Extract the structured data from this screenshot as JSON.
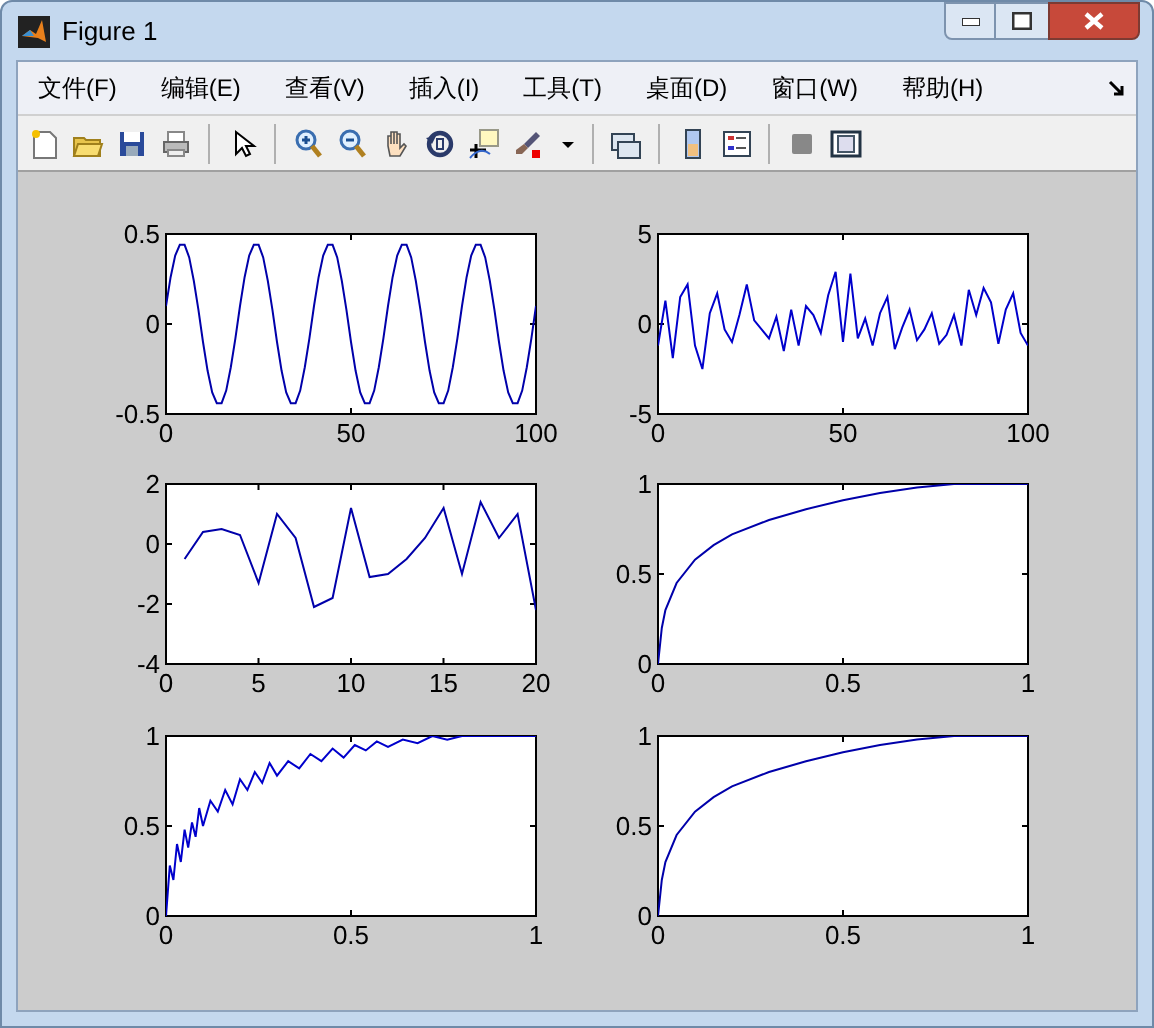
{
  "window": {
    "title": "Figure 1"
  },
  "menu": [
    "文件(F)",
    "编辑(E)",
    "查看(V)",
    "插入(I)",
    "工具(T)",
    "桌面(D)",
    "窗口(W)",
    "帮助(H)"
  ],
  "plots": [
    {
      "chart_data": {
        "type": "line",
        "x": [
          0,
          1.25,
          2.5,
          3.75,
          5,
          6.25,
          7.5,
          8.75,
          10,
          11.25,
          12.5,
          13.75,
          15,
          16.25,
          17.5,
          18.75,
          20,
          21.25,
          22.5,
          23.75,
          25,
          26.25,
          27.5,
          28.75,
          30,
          31.25,
          32.5,
          33.75,
          35,
          36.25,
          37.5,
          38.75,
          40,
          41.25,
          42.5,
          43.75,
          45,
          46.25,
          47.5,
          48.75,
          50,
          51.25,
          52.5,
          53.75,
          55,
          56.25,
          57.5,
          58.75,
          60,
          61.25,
          62.5,
          63.75,
          65,
          66.25,
          67.5,
          68.75,
          70,
          71.25,
          72.5,
          73.75,
          75,
          76.25,
          77.5,
          78.75,
          80,
          81.25,
          82.5,
          83.75,
          85,
          86.25,
          87.5,
          88.75,
          90,
          91.25,
          92.5,
          93.75,
          95,
          96.25,
          97.5,
          98.75,
          100
        ],
        "series": [
          {
            "color": "#0000aa",
            "values": [
              0.1,
              0.26,
              0.38,
              0.44,
              0.44,
              0.37,
              0.24,
              0.08,
              -0.1,
              -0.26,
              -0.38,
              -0.44,
              -0.44,
              -0.37,
              -0.24,
              -0.08,
              0.1,
              0.26,
              0.38,
              0.44,
              0.44,
              0.37,
              0.24,
              0.08,
              -0.1,
              -0.26,
              -0.38,
              -0.44,
              -0.44,
              -0.37,
              -0.24,
              -0.08,
              0.1,
              0.26,
              0.38,
              0.44,
              0.44,
              0.37,
              0.24,
              0.08,
              -0.1,
              -0.26,
              -0.38,
              -0.44,
              -0.44,
              -0.37,
              -0.24,
              -0.08,
              0.1,
              0.26,
              0.38,
              0.44,
              0.44,
              0.37,
              0.24,
              0.08,
              -0.1,
              -0.26,
              -0.38,
              -0.44,
              -0.44,
              -0.37,
              -0.24,
              -0.08,
              0.1,
              0.26,
              0.38,
              0.44,
              0.44,
              0.37,
              0.24,
              0.08,
              -0.1,
              -0.26,
              -0.38,
              -0.44,
              -0.44,
              -0.37,
              -0.24,
              -0.08,
              0.1
            ]
          }
        ],
        "xlim": [
          0,
          100
        ],
        "ylim": [
          -0.5,
          0.5
        ],
        "xticks": [
          0,
          50,
          100
        ],
        "yticks": [
          -0.5,
          0,
          0.5
        ]
      }
    },
    {
      "chart_data": {
        "type": "line",
        "x": [
          0,
          2,
          4,
          6,
          8,
          10,
          12,
          14,
          16,
          18,
          20,
          22,
          24,
          26,
          28,
          30,
          32,
          34,
          36,
          38,
          40,
          42,
          44,
          46,
          48,
          50,
          52,
          54,
          56,
          58,
          60,
          62,
          64,
          66,
          68,
          70,
          72,
          74,
          76,
          78,
          80,
          82,
          84,
          86,
          88,
          90,
          92,
          94,
          96,
          98,
          100
        ],
        "series": [
          {
            "color": "#0000cc",
            "values": [
              -1.2,
              1.3,
              -1.9,
              1.5,
              2.2,
              -1.2,
              -2.5,
              0.6,
              1.7,
              -0.3,
              -1,
              0.5,
              2.2,
              0.2,
              -0.3,
              -0.8,
              0.4,
              -1.5,
              0.8,
              -1.2,
              1,
              0.5,
              -0.5,
              1.6,
              2.9,
              -1,
              2.8,
              -0.8,
              0.3,
              -1.2,
              0.6,
              1.5,
              -1.4,
              -0.2,
              0.8,
              -0.9,
              -0.3,
              0.6,
              -1.1,
              -0.6,
              0.5,
              -1.2,
              1.9,
              0.5,
              2,
              1.2,
              -1.1,
              0.8,
              1.7,
              -0.5,
              -1.2
            ]
          }
        ],
        "xlim": [
          0,
          100
        ],
        "ylim": [
          -5,
          5
        ],
        "xticks": [
          0,
          50,
          100
        ],
        "yticks": [
          -5,
          0,
          5
        ]
      }
    },
    {
      "chart_data": {
        "type": "line",
        "x": [
          1,
          2,
          3,
          4,
          5,
          6,
          7,
          8,
          9,
          10,
          11,
          12,
          13,
          14,
          15,
          16,
          17,
          18,
          19,
          20
        ],
        "series": [
          {
            "color": "#0000aa",
            "values": [
              -0.5,
              0.4,
              0.5,
              0.3,
              -1.3,
              1,
              0.2,
              -2.1,
              -1.8,
              1.2,
              -1.1,
              -1,
              -0.5,
              0.2,
              1.2,
              -1,
              1.4,
              0.2,
              1,
              -2.2
            ]
          }
        ],
        "xlim": [
          0,
          20
        ],
        "ylim": [
          -4,
          2
        ],
        "xticks": [
          0,
          5,
          10,
          15,
          20
        ],
        "yticks": [
          -4,
          -2,
          0,
          2
        ]
      }
    },
    {
      "chart_data": {
        "type": "line",
        "x": [
          0,
          0.01,
          0.02,
          0.05,
          0.1,
          0.15,
          0.2,
          0.3,
          0.4,
          0.5,
          0.6,
          0.7,
          0.8,
          0.9,
          1
        ],
        "series": [
          {
            "color": "#0000aa",
            "values": [
              0,
              0.2,
              0.3,
              0.45,
              0.58,
              0.66,
              0.72,
              0.8,
              0.86,
              0.91,
              0.95,
              0.98,
              1,
              1,
              1
            ]
          }
        ],
        "xlim": [
          0,
          1
        ],
        "ylim": [
          0,
          1
        ],
        "xticks": [
          0,
          0.5,
          1
        ],
        "yticks": [
          0,
          0.5,
          1
        ]
      }
    },
    {
      "chart_data": {
        "type": "line",
        "x": [
          0,
          0.01,
          0.02,
          0.03,
          0.04,
          0.05,
          0.06,
          0.07,
          0.08,
          0.09,
          0.1,
          0.12,
          0.14,
          0.16,
          0.18,
          0.2,
          0.22,
          0.24,
          0.26,
          0.28,
          0.3,
          0.33,
          0.36,
          0.39,
          0.42,
          0.45,
          0.48,
          0.51,
          0.54,
          0.57,
          0.6,
          0.64,
          0.68,
          0.72,
          0.76,
          0.8,
          0.85,
          0.9,
          0.95,
          1
        ],
        "series": [
          {
            "color": "#0000cc",
            "values": [
              0,
              0.28,
              0.2,
              0.4,
              0.3,
              0.48,
              0.38,
              0.52,
              0.44,
              0.6,
              0.5,
              0.64,
              0.58,
              0.7,
              0.62,
              0.76,
              0.7,
              0.8,
              0.74,
              0.85,
              0.78,
              0.86,
              0.82,
              0.9,
              0.86,
              0.93,
              0.88,
              0.95,
              0.92,
              0.97,
              0.94,
              0.98,
              0.96,
              1,
              0.98,
              1,
              1,
              1,
              1,
              1
            ]
          }
        ],
        "xlim": [
          0,
          1
        ],
        "ylim": [
          0,
          1
        ],
        "xticks": [
          0,
          0.5,
          1
        ],
        "yticks": [
          0,
          0.5,
          1
        ]
      }
    },
    {
      "chart_data": {
        "type": "line",
        "x": [
          0,
          0.01,
          0.02,
          0.05,
          0.1,
          0.15,
          0.2,
          0.3,
          0.4,
          0.5,
          0.6,
          0.7,
          0.8,
          0.9,
          1
        ],
        "series": [
          {
            "color": "#0000aa",
            "values": [
              0,
              0.2,
              0.3,
              0.45,
              0.58,
              0.66,
              0.72,
              0.8,
              0.86,
              0.91,
              0.95,
              0.98,
              1,
              1,
              1
            ]
          }
        ],
        "xlim": [
          0,
          1
        ],
        "ylim": [
          0,
          1
        ],
        "xticks": [
          0,
          0.5,
          1
        ],
        "yticks": [
          0,
          0.5,
          1
        ]
      }
    }
  ]
}
